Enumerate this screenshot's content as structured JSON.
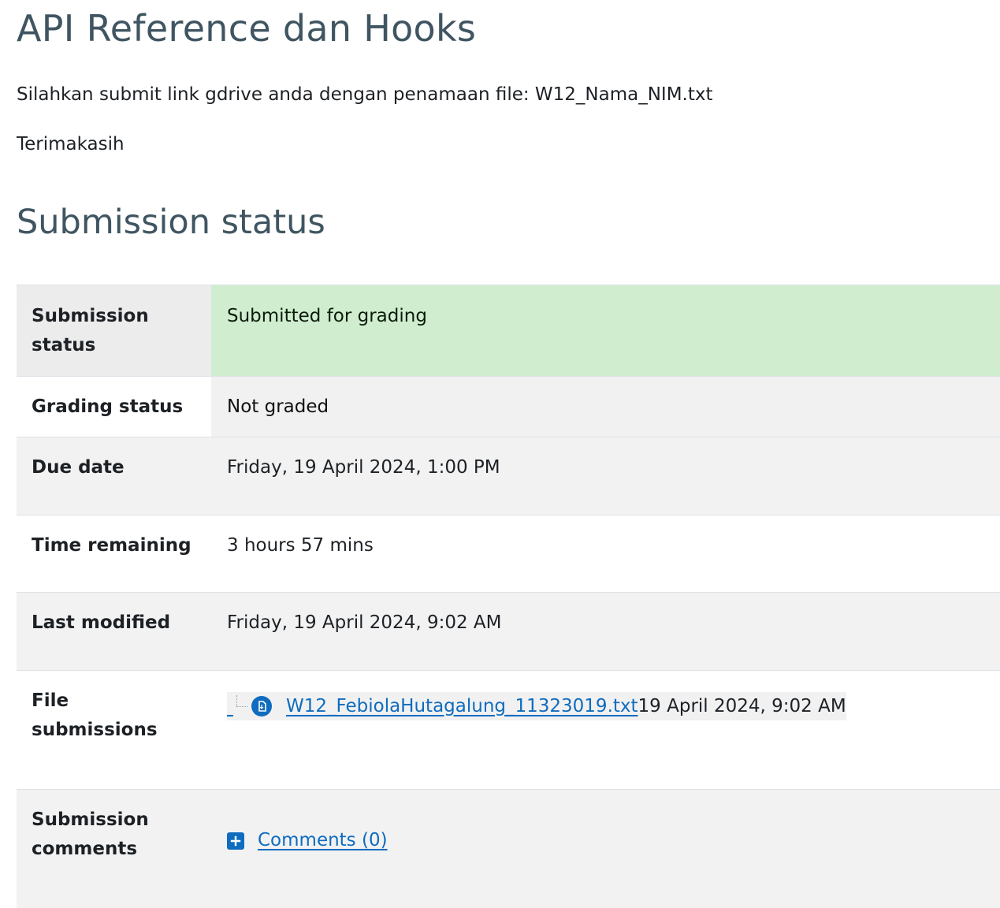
{
  "page": {
    "title": "API Reference dan Hooks",
    "intro": "Silahkan submit link gdrive anda dengan penamaan file: W12_Nama_NIM.txt",
    "thanks": "Terimakasih",
    "section_title": "Submission status"
  },
  "status_table": {
    "rows": [
      {
        "label": "Submission status",
        "value": "Submitted for grading"
      },
      {
        "label": "Grading status",
        "value": "Not graded"
      },
      {
        "label": "Due date",
        "value": "Friday, 19 April 2024, 1:00 PM"
      },
      {
        "label": "Time remaining",
        "value": "3 hours 57 mins"
      },
      {
        "label": "Last modified",
        "value": "Friday, 19 April 2024, 9:02 AM"
      },
      {
        "label": "File submissions",
        "file_name": "W12_FebiolaHutagalung_11323019.txt",
        "file_date": "19 April 2024, 9:02 AM",
        "icon": "document-icon"
      },
      {
        "label": "Submission comments",
        "comments_link": "Comments (0)",
        "icon": "plus-square-icon"
      }
    ]
  },
  "colors": {
    "heading": "#3f5561",
    "submitted_bg": "#d0eecf",
    "link": "#0f6cbf",
    "row_alt": "#f2f2f2"
  }
}
